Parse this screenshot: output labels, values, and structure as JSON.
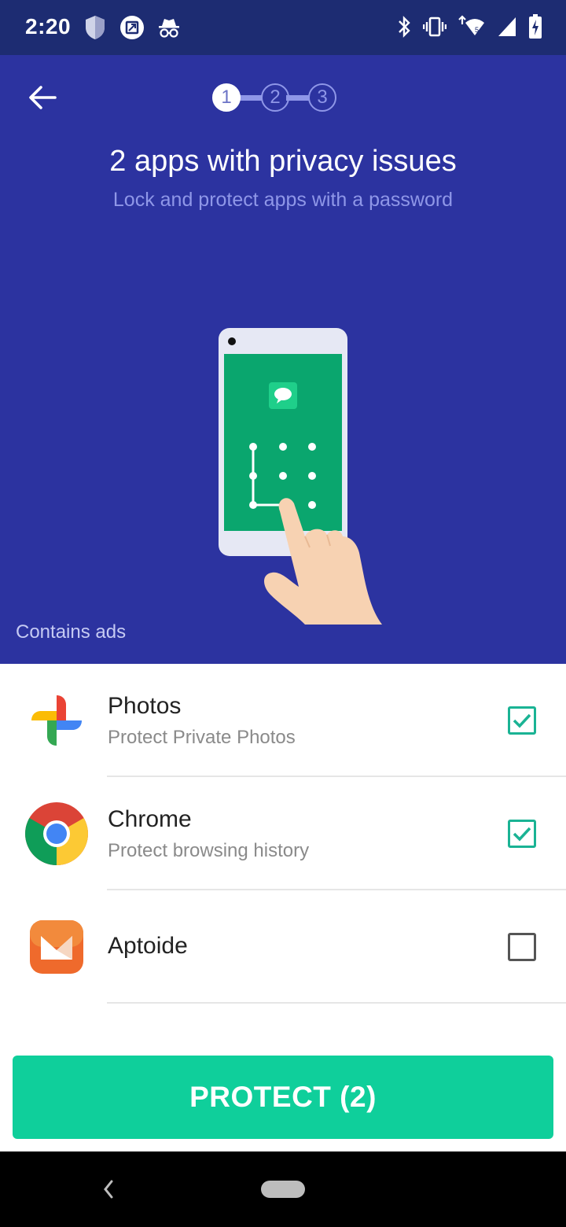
{
  "status_bar": {
    "time": "2:20",
    "left_icons": [
      "shield-icon",
      "screen-rotate-icon",
      "incognito-icon"
    ],
    "right_icons": [
      "bluetooth-icon",
      "vibrate-icon",
      "wifi-icon",
      "signal-icon",
      "battery-charging-icon"
    ]
  },
  "header": {
    "steps": [
      "1",
      "2",
      "3"
    ],
    "active_step": 1,
    "title": "2 apps with privacy issues",
    "subtitle": "Lock and protect apps with a password",
    "ads_label": "Contains ads"
  },
  "apps": [
    {
      "name": "Photos",
      "description": "Protect Private Photos",
      "checked": true,
      "icon": "google-photos-icon"
    },
    {
      "name": "Chrome",
      "description": "Protect browsing history",
      "checked": true,
      "icon": "chrome-icon"
    },
    {
      "name": "Aptoide",
      "description": "",
      "checked": false,
      "icon": "aptoide-icon"
    }
  ],
  "protect_button": {
    "label": "PROTECT (2)"
  },
  "colors": {
    "header_bg": "#2c33a0",
    "status_bg": "#1d2c72",
    "accent": "#0fcf9b",
    "checkbox": "#1ab394"
  }
}
